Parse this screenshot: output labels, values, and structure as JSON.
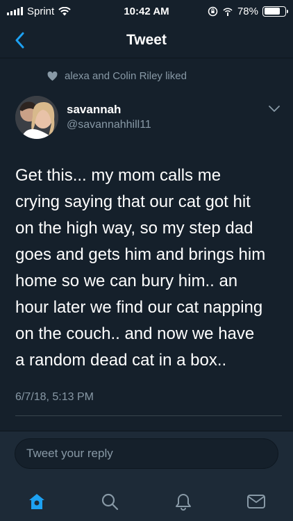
{
  "status_bar": {
    "carrier": "Sprint",
    "time": "10:42 AM",
    "battery_percent": "78%",
    "battery_level": 0.78
  },
  "nav": {
    "title": "Tweet",
    "back_icon": "chevron-left-icon"
  },
  "tweet": {
    "liked_by": "alexa and Colin Riley liked",
    "author_name": "savannah",
    "author_handle": "@savannahhill11",
    "text_lines": [
      "Get this... my mom calls me",
      "crying saying that our cat got hit",
      "on the high way, so my step dad",
      "goes and gets him and brings him",
      "home so we can bury him.. an",
      "hour later we find our cat napping",
      "on the couch.. and now we have",
      "a random dead cat in a box.."
    ],
    "timestamp": "6/7/18, 5:13 PM"
  },
  "reply": {
    "placeholder": "Tweet your reply"
  },
  "tabs": [
    {
      "name": "home",
      "icon": "home-icon",
      "active": true
    },
    {
      "name": "search",
      "icon": "search-icon",
      "active": false
    },
    {
      "name": "notifications",
      "icon": "bell-icon",
      "active": false
    },
    {
      "name": "messages",
      "icon": "mail-icon",
      "active": false
    }
  ],
  "colors": {
    "background": "#15202b",
    "secondary_text": "#8899a6",
    "accent": "#1da1f2"
  }
}
